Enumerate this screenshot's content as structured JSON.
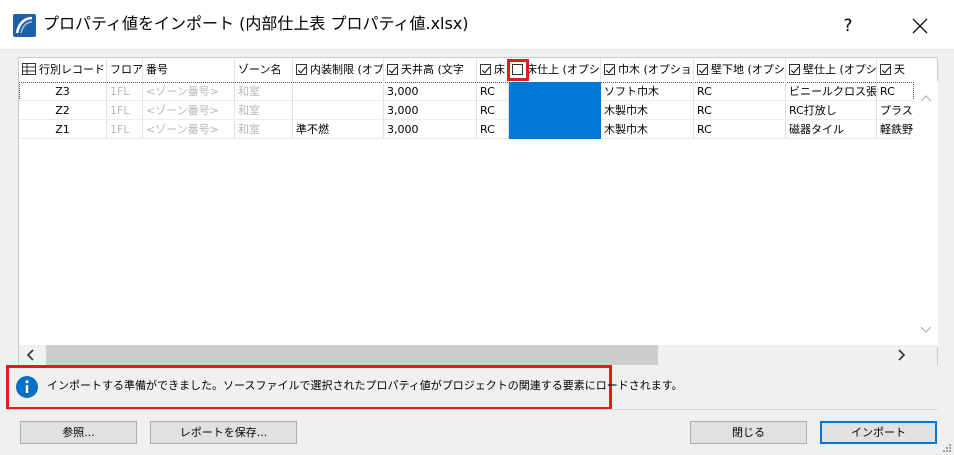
{
  "window": {
    "title": "プロパティ値をインポート (内部仕上表 プロパティ値.xlsx)",
    "help_label": "?"
  },
  "table": {
    "columns": [
      {
        "label": "行別レコード",
        "checkbox": false,
        "icon": "grid-icon"
      },
      {
        "label": "フロア",
        "checkbox": false
      },
      {
        "label": "番号",
        "checkbox": false
      },
      {
        "label": "ゾーン名",
        "checkbox": false
      },
      {
        "label": "内装制限 (オプ",
        "checkbox": true,
        "checked": true
      },
      {
        "label": "天井高 (文字",
        "checkbox": true,
        "checked": true
      },
      {
        "label": "床",
        "checkbox": true,
        "checked": true
      },
      {
        "label": "床仕上 (オプシ",
        "checkbox": true,
        "checked": false
      },
      {
        "label": "巾木 (オプショ",
        "checkbox": true,
        "checked": true
      },
      {
        "label": "壁下地 (オプシ",
        "checkbox": true,
        "checked": true
      },
      {
        "label": "壁仕上 (オプシ",
        "checkbox": true,
        "checked": true
      },
      {
        "label": "天",
        "checkbox": true,
        "checked": true
      }
    ],
    "rows": [
      {
        "cells": [
          "Z3",
          "1FL",
          "<ゾーン番号>",
          "和室",
          "",
          "3,000",
          "RC",
          "",
          "ソフト巾木",
          "RC",
          "ビニールクロス張",
          "RC"
        ]
      },
      {
        "cells": [
          "Z2",
          "1FL",
          "<ゾーン番号>",
          "和室",
          "",
          "3,000",
          "RC",
          "",
          "木製巾木",
          "RC",
          "RC打放し",
          "プラスタ"
        ]
      },
      {
        "cells": [
          "Z1",
          "1FL",
          "<ゾーン番号>",
          "和室",
          "準不燃",
          "3,000",
          "RC",
          "",
          "木製巾木",
          "RC",
          "磁器タイル",
          "軽鉄野"
        ]
      }
    ]
  },
  "status": {
    "icon": "info-icon",
    "message": "インポートする準備ができました。ソースファイルで選択されたプロパティ値がプロジェクトの関連する要素にロードされます。"
  },
  "buttons": {
    "browse": "参照...",
    "save_report": "レポートを保存...",
    "close": "閉じる",
    "import": "インポート"
  },
  "colors": {
    "selected_cell": "#0078d7",
    "highlight_box": "#e21b1b",
    "info_icon": "#0a6fc2"
  }
}
